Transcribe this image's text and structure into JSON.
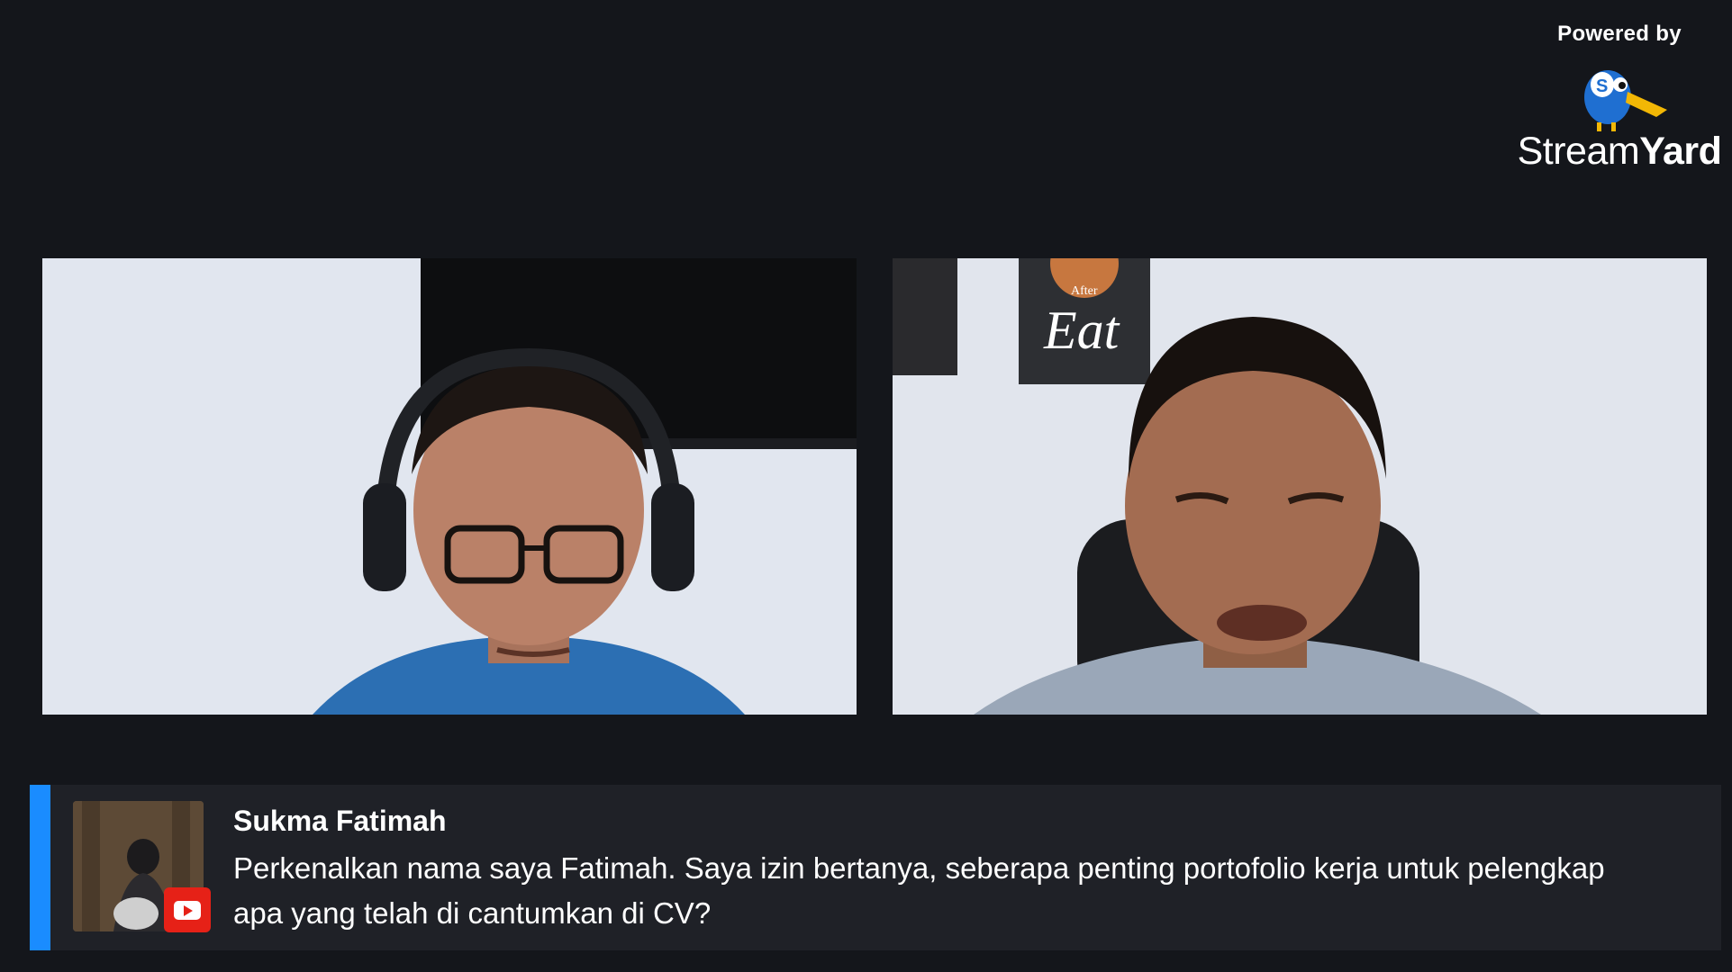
{
  "branding": {
    "powered_label": "Powered by",
    "logo_word_light": "Stream",
    "logo_word_bold": "Yard",
    "logo_icon": "streamyard-bird-icon"
  },
  "video_tiles": [
    {
      "name": "participant-left"
    },
    {
      "name": "participant-right",
      "wall_sign_text": "Eat",
      "wall_sign_small": "After"
    }
  ],
  "comment": {
    "author": "Sukma Fatimah",
    "platform_icon": "youtube-icon",
    "message": "Perkenalkan nama saya Fatimah. Saya izin bertanya, seberapa penting portofolio kerja untuk pelengkap apa yang telah di cantumkan di CV?"
  },
  "colors": {
    "background": "#14161b",
    "accent": "#1a8cff",
    "banner": "#1f2127",
    "youtube": "#e62117"
  }
}
